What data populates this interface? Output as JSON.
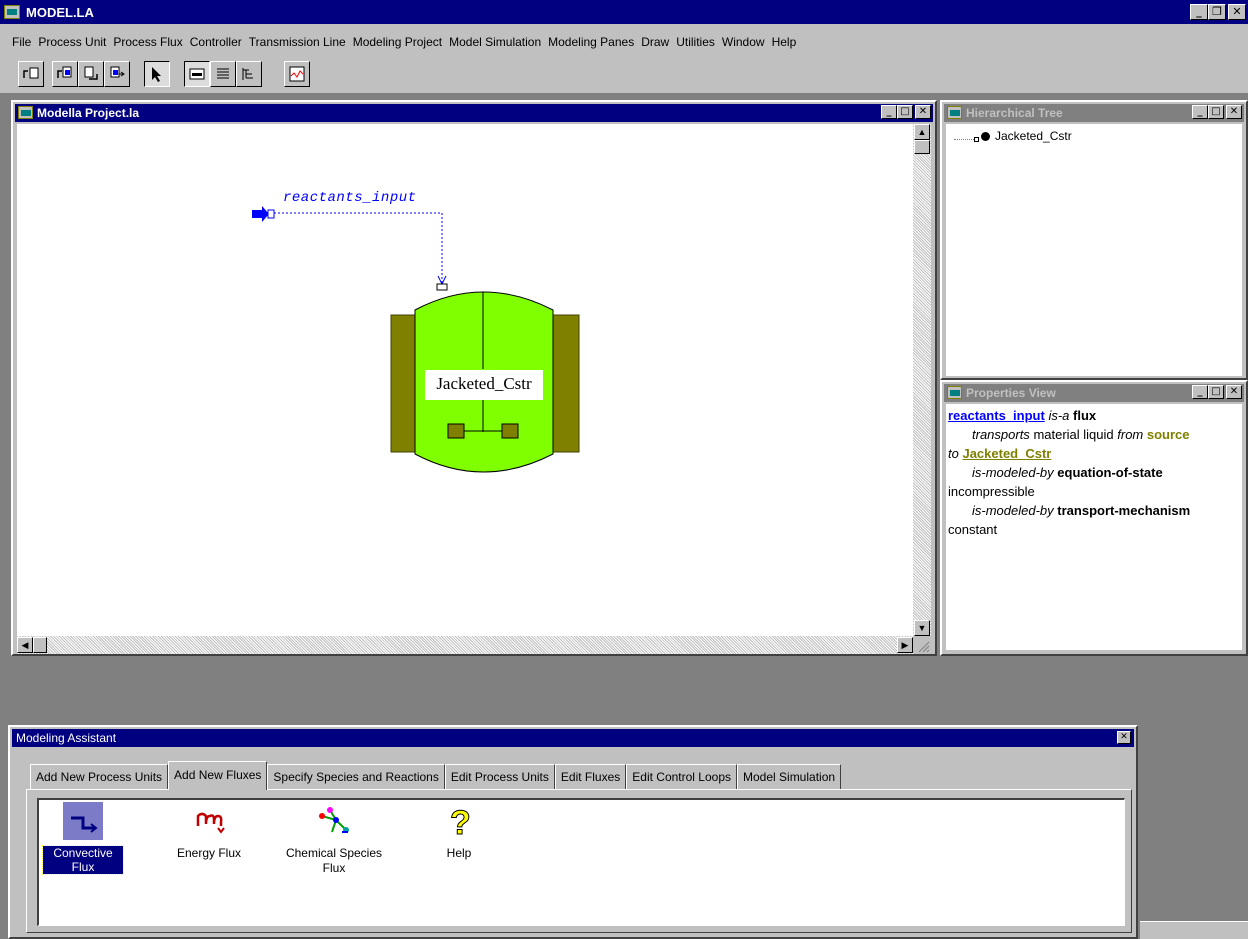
{
  "app": {
    "title": "MODEL.LA"
  },
  "menu": [
    "File",
    "Process Unit",
    "Process Flux",
    "Controller",
    "Transmission Line",
    "Modeling Project",
    "Model Simulation",
    "Modeling Panes",
    "Draw",
    "Utilities",
    "Window",
    "Help"
  ],
  "windows": {
    "project": {
      "title": "Modella Project.la"
    },
    "tree": {
      "title": "Hierarchical Tree",
      "root": "Jacketed_Cstr"
    },
    "properties": {
      "title": "Properties View"
    }
  },
  "diagram": {
    "flux_label": "reactants_input",
    "unit_label": "Jacketed_Cstr"
  },
  "properties": {
    "subject": "reactants_input",
    "is_a": "is-a",
    "type": "flux",
    "transports": "transports",
    "material": "material liquid",
    "from": "from",
    "source": "source",
    "to": "to",
    "target": "Jacketed_Cstr",
    "modeled_by_1": "is-modeled-by",
    "model_1": "equation-of-state",
    "value_1": "incompressible",
    "modeled_by_2": "is-modeled-by",
    "model_2": "transport-mechanism",
    "value_2": "constant"
  },
  "assistant": {
    "title": "Modeling Assistant",
    "tabs": [
      "Add New Process Units",
      "Add New Fluxes",
      "Specify Species and Reactions",
      "Edit Process Units",
      "Edit Fluxes",
      "Edit Control Loops",
      "Model Simulation"
    ],
    "active_tab": "Add New Fluxes",
    "tools": [
      "Convective Flux",
      "Energy Flux",
      "Chemical Species\nFlux",
      "Help"
    ],
    "selected_tool": "Convective Flux"
  },
  "colors": {
    "titlebar": "#000080",
    "vessel": "#80ff00",
    "jacket": "#808000",
    "link": "#0000ff"
  }
}
